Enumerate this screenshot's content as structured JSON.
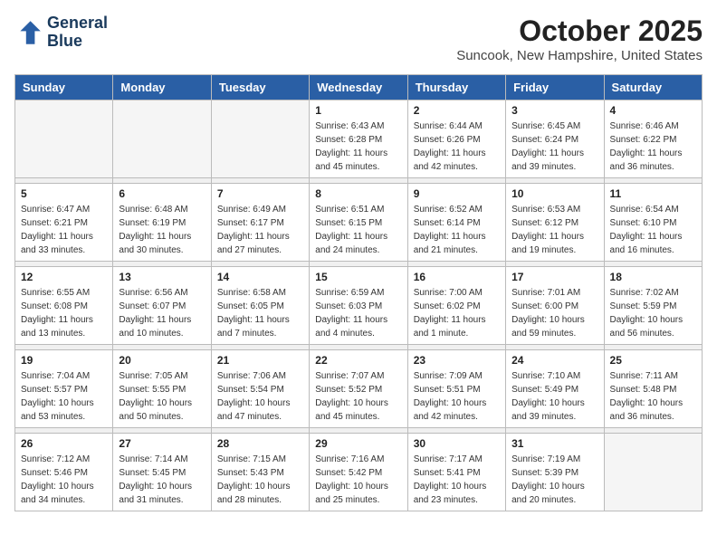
{
  "header": {
    "logo_line1": "General",
    "logo_line2": "Blue",
    "month": "October 2025",
    "location": "Suncook, New Hampshire, United States"
  },
  "weekdays": [
    "Sunday",
    "Monday",
    "Tuesday",
    "Wednesday",
    "Thursday",
    "Friday",
    "Saturday"
  ],
  "weeks": [
    [
      {
        "day": "",
        "sunrise": "",
        "sunset": "",
        "daylight": ""
      },
      {
        "day": "",
        "sunrise": "",
        "sunset": "",
        "daylight": ""
      },
      {
        "day": "",
        "sunrise": "",
        "sunset": "",
        "daylight": ""
      },
      {
        "day": "1",
        "sunrise": "Sunrise: 6:43 AM",
        "sunset": "Sunset: 6:28 PM",
        "daylight": "Daylight: 11 hours and 45 minutes."
      },
      {
        "day": "2",
        "sunrise": "Sunrise: 6:44 AM",
        "sunset": "Sunset: 6:26 PM",
        "daylight": "Daylight: 11 hours and 42 minutes."
      },
      {
        "day": "3",
        "sunrise": "Sunrise: 6:45 AM",
        "sunset": "Sunset: 6:24 PM",
        "daylight": "Daylight: 11 hours and 39 minutes."
      },
      {
        "day": "4",
        "sunrise": "Sunrise: 6:46 AM",
        "sunset": "Sunset: 6:22 PM",
        "daylight": "Daylight: 11 hours and 36 minutes."
      }
    ],
    [
      {
        "day": "5",
        "sunrise": "Sunrise: 6:47 AM",
        "sunset": "Sunset: 6:21 PM",
        "daylight": "Daylight: 11 hours and 33 minutes."
      },
      {
        "day": "6",
        "sunrise": "Sunrise: 6:48 AM",
        "sunset": "Sunset: 6:19 PM",
        "daylight": "Daylight: 11 hours and 30 minutes."
      },
      {
        "day": "7",
        "sunrise": "Sunrise: 6:49 AM",
        "sunset": "Sunset: 6:17 PM",
        "daylight": "Daylight: 11 hours and 27 minutes."
      },
      {
        "day": "8",
        "sunrise": "Sunrise: 6:51 AM",
        "sunset": "Sunset: 6:15 PM",
        "daylight": "Daylight: 11 hours and 24 minutes."
      },
      {
        "day": "9",
        "sunrise": "Sunrise: 6:52 AM",
        "sunset": "Sunset: 6:14 PM",
        "daylight": "Daylight: 11 hours and 21 minutes."
      },
      {
        "day": "10",
        "sunrise": "Sunrise: 6:53 AM",
        "sunset": "Sunset: 6:12 PM",
        "daylight": "Daylight: 11 hours and 19 minutes."
      },
      {
        "day": "11",
        "sunrise": "Sunrise: 6:54 AM",
        "sunset": "Sunset: 6:10 PM",
        "daylight": "Daylight: 11 hours and 16 minutes."
      }
    ],
    [
      {
        "day": "12",
        "sunrise": "Sunrise: 6:55 AM",
        "sunset": "Sunset: 6:08 PM",
        "daylight": "Daylight: 11 hours and 13 minutes."
      },
      {
        "day": "13",
        "sunrise": "Sunrise: 6:56 AM",
        "sunset": "Sunset: 6:07 PM",
        "daylight": "Daylight: 11 hours and 10 minutes."
      },
      {
        "day": "14",
        "sunrise": "Sunrise: 6:58 AM",
        "sunset": "Sunset: 6:05 PM",
        "daylight": "Daylight: 11 hours and 7 minutes."
      },
      {
        "day": "15",
        "sunrise": "Sunrise: 6:59 AM",
        "sunset": "Sunset: 6:03 PM",
        "daylight": "Daylight: 11 hours and 4 minutes."
      },
      {
        "day": "16",
        "sunrise": "Sunrise: 7:00 AM",
        "sunset": "Sunset: 6:02 PM",
        "daylight": "Daylight: 11 hours and 1 minute."
      },
      {
        "day": "17",
        "sunrise": "Sunrise: 7:01 AM",
        "sunset": "Sunset: 6:00 PM",
        "daylight": "Daylight: 10 hours and 59 minutes."
      },
      {
        "day": "18",
        "sunrise": "Sunrise: 7:02 AM",
        "sunset": "Sunset: 5:59 PM",
        "daylight": "Daylight: 10 hours and 56 minutes."
      }
    ],
    [
      {
        "day": "19",
        "sunrise": "Sunrise: 7:04 AM",
        "sunset": "Sunset: 5:57 PM",
        "daylight": "Daylight: 10 hours and 53 minutes."
      },
      {
        "day": "20",
        "sunrise": "Sunrise: 7:05 AM",
        "sunset": "Sunset: 5:55 PM",
        "daylight": "Daylight: 10 hours and 50 minutes."
      },
      {
        "day": "21",
        "sunrise": "Sunrise: 7:06 AM",
        "sunset": "Sunset: 5:54 PM",
        "daylight": "Daylight: 10 hours and 47 minutes."
      },
      {
        "day": "22",
        "sunrise": "Sunrise: 7:07 AM",
        "sunset": "Sunset: 5:52 PM",
        "daylight": "Daylight: 10 hours and 45 minutes."
      },
      {
        "day": "23",
        "sunrise": "Sunrise: 7:09 AM",
        "sunset": "Sunset: 5:51 PM",
        "daylight": "Daylight: 10 hours and 42 minutes."
      },
      {
        "day": "24",
        "sunrise": "Sunrise: 7:10 AM",
        "sunset": "Sunset: 5:49 PM",
        "daylight": "Daylight: 10 hours and 39 minutes."
      },
      {
        "day": "25",
        "sunrise": "Sunrise: 7:11 AM",
        "sunset": "Sunset: 5:48 PM",
        "daylight": "Daylight: 10 hours and 36 minutes."
      }
    ],
    [
      {
        "day": "26",
        "sunrise": "Sunrise: 7:12 AM",
        "sunset": "Sunset: 5:46 PM",
        "daylight": "Daylight: 10 hours and 34 minutes."
      },
      {
        "day": "27",
        "sunrise": "Sunrise: 7:14 AM",
        "sunset": "Sunset: 5:45 PM",
        "daylight": "Daylight: 10 hours and 31 minutes."
      },
      {
        "day": "28",
        "sunrise": "Sunrise: 7:15 AM",
        "sunset": "Sunset: 5:43 PM",
        "daylight": "Daylight: 10 hours and 28 minutes."
      },
      {
        "day": "29",
        "sunrise": "Sunrise: 7:16 AM",
        "sunset": "Sunset: 5:42 PM",
        "daylight": "Daylight: 10 hours and 25 minutes."
      },
      {
        "day": "30",
        "sunrise": "Sunrise: 7:17 AM",
        "sunset": "Sunset: 5:41 PM",
        "daylight": "Daylight: 10 hours and 23 minutes."
      },
      {
        "day": "31",
        "sunrise": "Sunrise: 7:19 AM",
        "sunset": "Sunset: 5:39 PM",
        "daylight": "Daylight: 10 hours and 20 minutes."
      },
      {
        "day": "",
        "sunrise": "",
        "sunset": "",
        "daylight": ""
      }
    ]
  ]
}
